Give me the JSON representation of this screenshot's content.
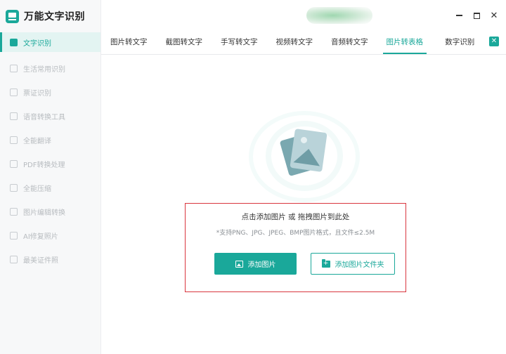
{
  "app": {
    "title": "万能文字识别"
  },
  "sidebar": {
    "items": [
      {
        "label": "文字识别",
        "icon": "scan-text-icon",
        "active": true
      },
      {
        "label": "生活常用识别",
        "icon": "life-scan-icon"
      },
      {
        "label": "票证识别",
        "icon": "ticket-icon"
      },
      {
        "label": "语音转换工具",
        "icon": "voice-icon"
      },
      {
        "label": "全能翻译",
        "icon": "translate-icon"
      },
      {
        "label": "PDF转换处理",
        "icon": "pdf-icon"
      },
      {
        "label": "全能压缩",
        "icon": "compress-icon"
      },
      {
        "label": "图片编辑转换",
        "icon": "image-edit-icon"
      },
      {
        "label": "AI修复照片",
        "icon": "ai-repair-icon"
      },
      {
        "label": "最美证件照",
        "icon": "id-photo-icon"
      }
    ]
  },
  "tabs": [
    {
      "label": "图片转文字"
    },
    {
      "label": "截图转文字"
    },
    {
      "label": "手写转文字"
    },
    {
      "label": "视频转文字"
    },
    {
      "label": "音频转文字"
    },
    {
      "label": "图片转表格",
      "active": true
    },
    {
      "label": "数字识别"
    }
  ],
  "window": {
    "close_glyph": "✕",
    "expand_glyph": "✕"
  },
  "upload": {
    "title": "点击添加图片 或 拖拽图片到此处",
    "hint": "*支持PNG、JPG、JPEG、BMP图片格式，且文件≤2.5M",
    "add_image_label": "添加图片",
    "add_folder_label": "添加图片文件夹"
  },
  "colors": {
    "accent": "#1aa89a",
    "highlight_border": "#d9363e"
  }
}
